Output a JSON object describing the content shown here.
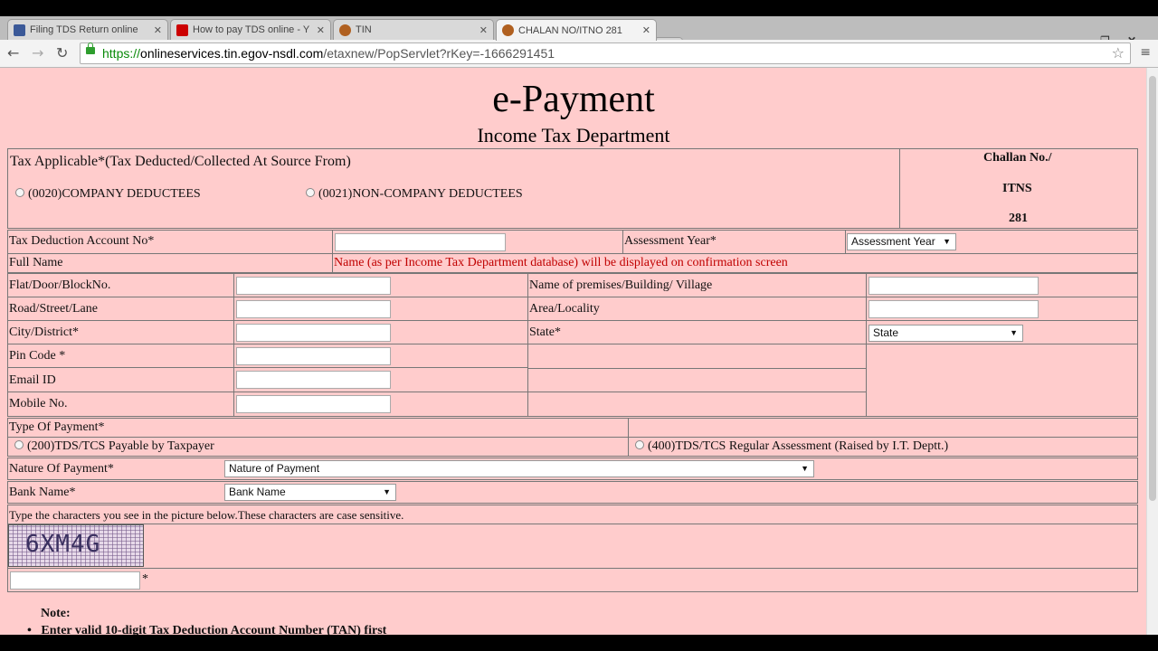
{
  "browser": {
    "tabs": [
      {
        "title": "Filing TDS Return online",
        "icon_color": "#3b5998"
      },
      {
        "title": "How to pay TDS online - Y",
        "icon_color": "#cc0000"
      },
      {
        "title": "TIN",
        "icon_color": "#b06020"
      },
      {
        "title": "CHALAN NO/ITNO 281",
        "icon_color": "#b06020"
      }
    ],
    "url_scheme": "https://",
    "url_host": "onlineservices.tin.egov-nsdl.com",
    "url_path": "/etaxnew/PopServlet?rKey=-1666291451",
    "back_icon": "back-arrow-icon",
    "forward_icon": "forward-arrow-icon",
    "reload_icon": "reload-icon"
  },
  "page": {
    "title": "e-Payment",
    "subtitle": "Income Tax Department",
    "tax_applicable_label": "Tax Applicable*(Tax Deducted/Collected At Source From)",
    "option_0020": "(0020)COMPANY DEDUCTEES",
    "option_0021": "(0021)NON-COMPANY DEDUCTEES",
    "challan_label": "Challan No./",
    "itns_label": "ITNS",
    "itns_no": "281",
    "tan_label": "Tax Deduction Account No*",
    "assessment_year_label": "Assessment Year*",
    "assessment_year_select": "Assessment Year",
    "full_name_label": "Full Name",
    "full_name_note": "Name (as per Income Tax Department database) will be displayed on confirmation screen",
    "flat_label": "Flat/Door/BlockNo.",
    "premises_label": "Name of premises/Building/ Village",
    "road_label": "Road/Street/Lane",
    "area_label": "Area/Locality",
    "city_label": "City/District*",
    "state_label": "State*",
    "state_select": "State",
    "pin_label": "Pin Code *",
    "email_label": "Email ID",
    "mobile_label": "Mobile No.",
    "payment_type_label": "Type Of Payment*",
    "payment_200": "(200)TDS/TCS Payable by Taxpayer",
    "payment_400": "(400)TDS/TCS Regular Assessment (Raised by I.T. Deptt.)",
    "nature_label": "Nature Of Payment*",
    "nature_select": "Nature of Payment",
    "bank_label": "Bank Name*",
    "bank_select": "Bank Name",
    "captcha_instruction": "Type the characters you see in the picture below.These characters are case sensitive.",
    "captcha_text": "6XM4G",
    "captcha_required": "*",
    "note_heading": "Note:",
    "note_item_1": "Enter valid 10-digit Tax Deduction Account Number (TAN) first"
  }
}
